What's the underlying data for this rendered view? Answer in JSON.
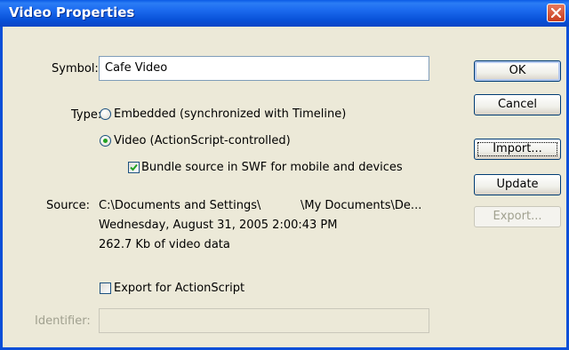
{
  "window": {
    "title": "Video Properties"
  },
  "form": {
    "symbol_label": "Symbol:",
    "symbol_value": "Cafe Video",
    "type_label": "Type:",
    "type_options": [
      {
        "label": "Embedded (synchronized with Timeline)",
        "selected": false
      },
      {
        "label": "Video (ActionScript-controlled)",
        "selected": true
      }
    ],
    "bundle_label": "Bundle source in SWF for mobile and devices",
    "bundle_checked": true,
    "source_label": "Source:",
    "source_path_left": "C:\\Documents and Settings\\",
    "source_path_right": "\\My Documents\\De...",
    "source_date": "Wednesday, August 31, 2005  2:00:43 PM",
    "source_size": "262.7 Kb of video data",
    "export_label": "Export for ActionScript",
    "export_checked": false,
    "identifier_label": "Identifier:",
    "identifier_value": ""
  },
  "buttons": {
    "ok": "OK",
    "cancel": "Cancel",
    "import": "Import...",
    "update": "Update",
    "export": "Export..."
  },
  "colors": {
    "title_bar": "#0a5be0",
    "close_button": "#d9532f",
    "dialog_bg": "#ece9d8",
    "radio_dot": "#21a121",
    "check_mark": "#21a121"
  }
}
